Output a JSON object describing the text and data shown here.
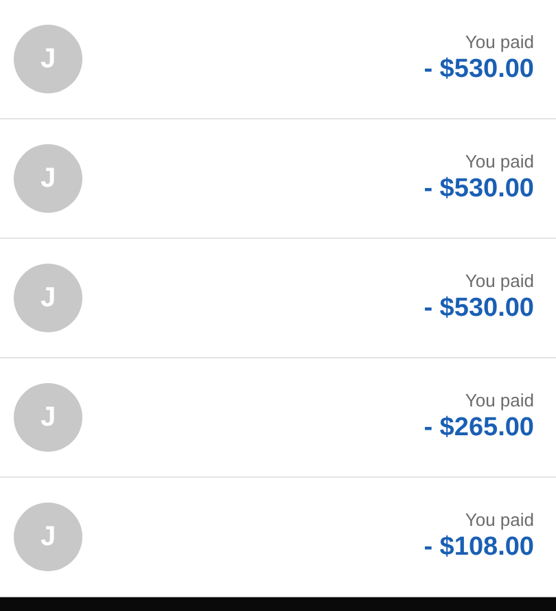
{
  "transactions": [
    {
      "avatar": "J",
      "label": "You paid",
      "amount": "- $530.00"
    },
    {
      "avatar": "J",
      "label": "You paid",
      "amount": "- $530.00"
    },
    {
      "avatar": "J",
      "label": "You paid",
      "amount": "- $530.00"
    },
    {
      "avatar": "J",
      "label": "You paid",
      "amount": "- $265.00"
    },
    {
      "avatar": "J",
      "label": "You paid",
      "amount": "- $108.00"
    }
  ]
}
